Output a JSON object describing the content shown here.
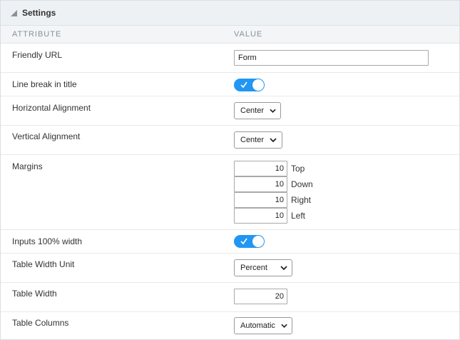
{
  "panel": {
    "title": "Settings",
    "columns": {
      "attribute": "ATTRIBUTE",
      "value": "VALUE"
    }
  },
  "rows": {
    "friendly_url": {
      "label": "Friendly URL",
      "value": "Form"
    },
    "line_break": {
      "label": "Line break in title",
      "checked": true
    },
    "horizontal_alignment": {
      "label": "Horizontal Alignment",
      "selected": "Center"
    },
    "vertical_alignment": {
      "label": "Vertical Alignment",
      "selected": "Center"
    },
    "margins": {
      "label": "Margins",
      "items": [
        {
          "value": "10",
          "side": "Top"
        },
        {
          "value": "10",
          "side": "Down"
        },
        {
          "value": "10",
          "side": "Right"
        },
        {
          "value": "10",
          "side": "Left"
        }
      ]
    },
    "inputs_full_width": {
      "label": "Inputs 100% width",
      "checked": true
    },
    "table_width_unit": {
      "label": "Table Width Unit",
      "selected": "Percent"
    },
    "table_width": {
      "label": "Table Width",
      "value": "20"
    },
    "table_columns": {
      "label": "Table Columns",
      "selected": "Automatic"
    }
  },
  "colors": {
    "toggle_on": "#2196f3",
    "header_bg": "#eef1f4",
    "column_header_text": "#8a9199"
  },
  "icons": {
    "collapse": "triangle-collapse-icon",
    "select": "chevron-down-icon",
    "toggle": "check-icon"
  }
}
